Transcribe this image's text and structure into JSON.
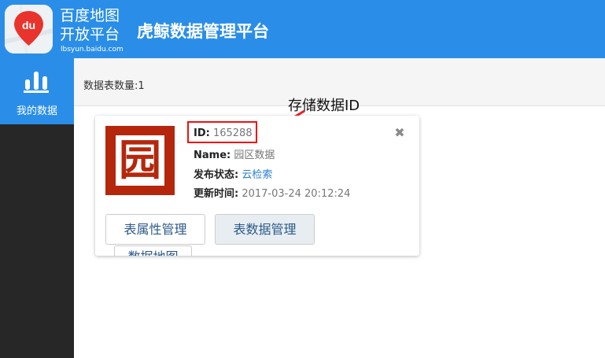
{
  "header": {
    "logo_line1": "百度地图",
    "logo_line2": "开放平台",
    "logo_url": "lbsyun.baidu.com",
    "logo_badge": "du",
    "app_title": "虎鲸数据管理平台"
  },
  "sidebar": {
    "items": [
      {
        "label": "我的数据",
        "icon": "bar-chart-icon"
      }
    ]
  },
  "topbar": {
    "table_count": "数据表数量:1"
  },
  "annotation": {
    "text": "存储数据ID"
  },
  "card": {
    "image_char": "园",
    "id_key": "ID:",
    "id_value": "165288",
    "name_key": "Name:",
    "name_value": "园区数据",
    "status_key": "发布状态:",
    "status_value": "云检索",
    "time_key": "更新时间:",
    "time_value": "2017-03-24 20:12:24",
    "buttons": [
      "表属性管理",
      "表数据管理",
      "数据地图"
    ]
  },
  "colors": {
    "primary": "#2a8ee8",
    "sidebar_bg": "#272727",
    "card_image": "#b5270c",
    "highlight": "#ee1111",
    "link": "#2a7ed3"
  }
}
